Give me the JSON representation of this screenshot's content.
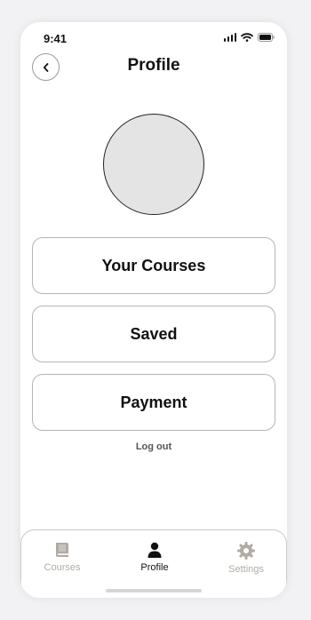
{
  "status_bar": {
    "time": "9:41"
  },
  "header": {
    "title": "Profile",
    "back_icon": "chevron-left-icon"
  },
  "profile": {
    "avatar_color": "#e4e4e4"
  },
  "menu": {
    "items": [
      {
        "label": "Your Courses"
      },
      {
        "label": "Saved"
      },
      {
        "label": "Payment"
      }
    ],
    "logout_label": "Log out"
  },
  "tab_bar": {
    "active_color": "#111111",
    "inactive_color": "#b0aca4",
    "tabs": [
      {
        "label": "Courses",
        "icon": "book-icon",
        "active": false
      },
      {
        "label": "Profile",
        "icon": "person-icon",
        "active": true
      },
      {
        "label": "Settings",
        "icon": "gear-icon",
        "active": false
      }
    ]
  }
}
